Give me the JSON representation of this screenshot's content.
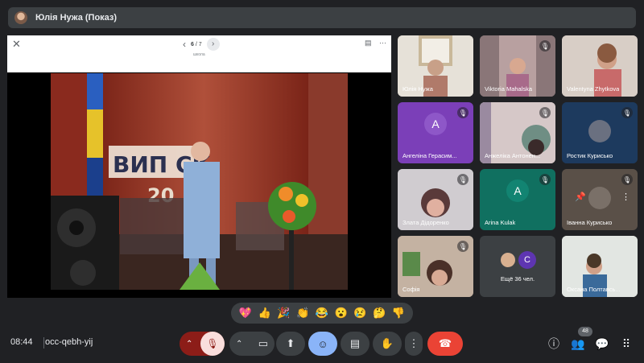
{
  "meeting": {
    "presenter_title": "Юлія Нужа (Показ)"
  },
  "presentation": {
    "page_current": "6",
    "page_total": "/ 7",
    "subtitle": "школа",
    "banner_text": "ВИП СК",
    "banner_year": "20"
  },
  "participants": [
    {
      "name": "Юлія Нужа",
      "muted": false
    },
    {
      "name": "Viktoria Mahalska",
      "muted": true
    },
    {
      "name": "Valentyna Zhytkova",
      "muted": false
    },
    {
      "name": "Ангеліна Герасим...",
      "muted": true,
      "letter": "А"
    },
    {
      "name": "Анжеліка Антонен...",
      "muted": true
    },
    {
      "name": "Ростик Курисько",
      "muted": true
    },
    {
      "name": "Злата Дідоренко",
      "muted": true
    },
    {
      "name": "Arina Kulak",
      "muted": true,
      "letter": "A"
    },
    {
      "name": "Іванна Курисько",
      "muted": true
    },
    {
      "name": "Софія",
      "muted": true
    },
    {
      "name": "Ещё 36 чел.",
      "letter": "C"
    },
    {
      "name": "Оксана Полтавсь...",
      "muted": true
    }
  ],
  "reactions": [
    "💖",
    "👍",
    "🎉",
    "👏",
    "😂",
    "😮",
    "😢",
    "🤔",
    "👎"
  ],
  "bottombar": {
    "time": "08:44",
    "meeting_code": "occ-qebh-yij",
    "participants_count": "48"
  },
  "colors": {
    "background": "#202124",
    "surface": "#3c4043",
    "hangup": "#ea4335",
    "mic_off": "#f9dedc",
    "mic_group": "#8c1d18",
    "reaction_active": "#8ab4f8"
  }
}
